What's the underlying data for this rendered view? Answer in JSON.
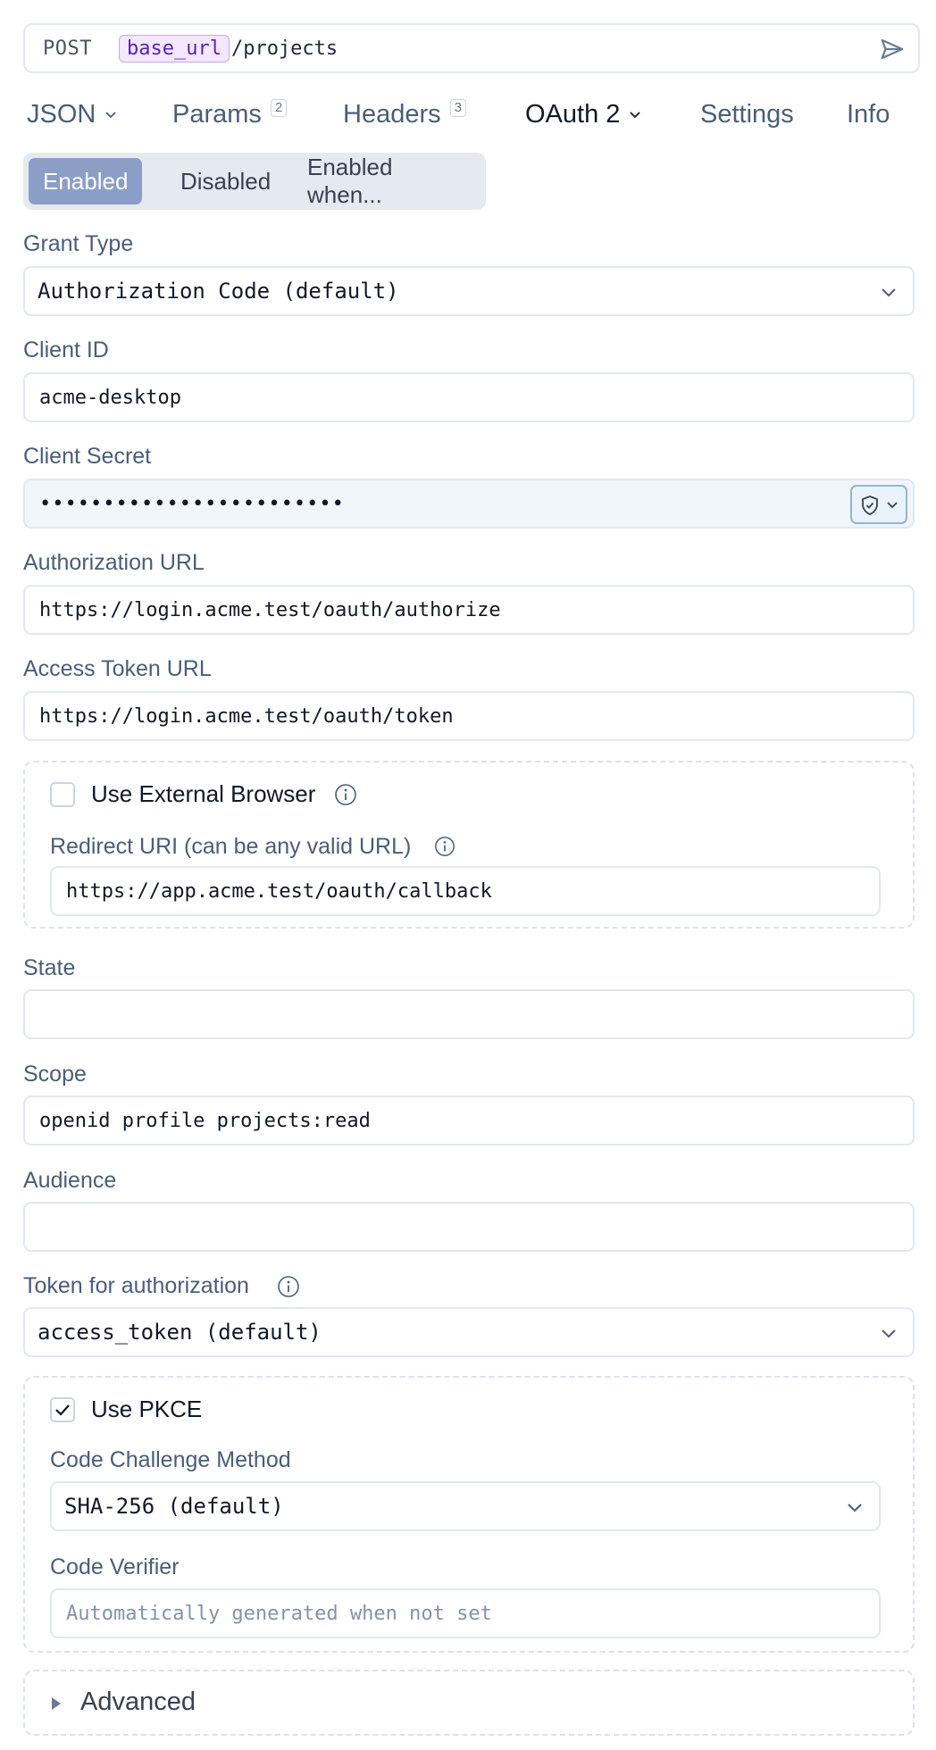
{
  "request": {
    "method": "POST",
    "url_variable": "base_url",
    "url_path": "/projects"
  },
  "tabs": [
    {
      "label": "JSON",
      "has_dropdown": true
    },
    {
      "label": "Params",
      "badge": "2"
    },
    {
      "label": "Headers",
      "badge": "3"
    },
    {
      "label": "OAuth 2",
      "has_dropdown": true,
      "active": true
    },
    {
      "label": "Settings"
    },
    {
      "label": "Info"
    }
  ],
  "enabled_toggle": {
    "options": [
      "Enabled",
      "Disabled",
      "Enabled when..."
    ],
    "selected": "Enabled"
  },
  "form": {
    "grant_type": {
      "label": "Grant Type",
      "value": "Authorization Code (default)"
    },
    "client_id": {
      "label": "Client ID",
      "value": "acme-desktop"
    },
    "client_secret": {
      "label": "Client Secret",
      "value": "••••••••••••••••••••••••"
    },
    "authorization_url": {
      "label": "Authorization URL",
      "value": "https://login.acme.test/oauth/authorize"
    },
    "access_token_url": {
      "label": "Access Token URL",
      "value": "https://login.acme.test/oauth/token"
    },
    "external_browser": {
      "label": "Use External Browser",
      "checked": false,
      "redirect_label": "Redirect URI (can be any valid URL)",
      "redirect_value": "https://app.acme.test/oauth/callback"
    },
    "state": {
      "label": "State",
      "value": ""
    },
    "scope": {
      "label": "Scope",
      "value": "openid profile projects:read"
    },
    "audience": {
      "label": "Audience",
      "value": ""
    },
    "token_for_authorization": {
      "label": "Token for authorization",
      "value": "access_token (default)"
    },
    "pkce": {
      "label": "Use PKCE",
      "checked": true,
      "method_label": "Code Challenge Method",
      "method_value": "SHA-256 (default)",
      "verifier_label": "Code Verifier",
      "verifier_placeholder": "Automatically generated when not set"
    },
    "advanced": {
      "label": "Advanced"
    }
  },
  "colors": {
    "accent": "#8a9ec6",
    "label": "#4a5d7a",
    "variable_bg": "#f3e8ff",
    "variable_text": "#5b21b6"
  }
}
